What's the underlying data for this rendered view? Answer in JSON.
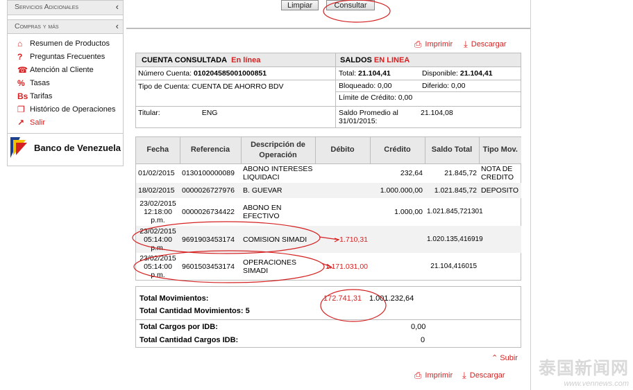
{
  "sidebar": {
    "section1": "Servicios Adicionales",
    "section2": "Compras y más",
    "items": [
      {
        "icon": "house-icon",
        "glyph": "⌂",
        "label": "Resumen de Productos"
      },
      {
        "icon": "question-icon",
        "glyph": "?",
        "label": "Preguntas Frecuentes"
      },
      {
        "icon": "phone-icon",
        "glyph": "☎",
        "label": "Atención al Cliente"
      },
      {
        "icon": "percent-icon",
        "glyph": "%",
        "label": "Tasas"
      },
      {
        "icon": "bs-icon",
        "glyph": "Bs",
        "label": "Tarifas"
      },
      {
        "icon": "history-icon",
        "glyph": "❐",
        "label": "Histórico de Operaciones"
      },
      {
        "icon": "exit-icon",
        "glyph": "↗",
        "label": "Salir"
      }
    ],
    "logo_text": "Banco de Venezuela"
  },
  "toolbar": {
    "clear_label": "Limpiar",
    "query_label": "Consultar"
  },
  "actions": {
    "print_label": "Imprimir",
    "download_label": "Descargar",
    "top_label": "Subir"
  },
  "account": {
    "title": "CUENTA CONSULTADA",
    "title_status": "En línea",
    "balances_title": "SALDOS",
    "balances_status": "EN LINEA",
    "number_label": "Número Cuenta:",
    "number_value": "010204585001000851",
    "type_label": "Tipo de Cuenta:",
    "type_value": "CUENTA DE AHORRO BDV",
    "holder_label": "Titular:",
    "holder_value": "ENG",
    "total_label": "Total:",
    "total_value": "21.104,41",
    "available_label": "Disponible:",
    "available_value": "21.104,41",
    "blocked_label": "Bloqueado: 0,00",
    "deferred_label": "Diferido: 0,00",
    "credit_limit_label": "Límite de Crédito: 0,00",
    "avg_label": "Saldo Promedio al 31/01/2015:",
    "avg_value": "21.104,08"
  },
  "movements": {
    "columns": [
      "Fecha",
      "Referencia",
      "Descripción de Operación",
      "Débito",
      "Crédito",
      "Saldo Total",
      "Tipo Mov."
    ],
    "rows": [
      {
        "fecha": "01/02/2015",
        "ref": "0130100000089",
        "desc": "ABONO INTERESES LIQUIDACI",
        "debito": "",
        "credito": "232,64",
        "saldo": "21.845,72",
        "tipo": "NOTA DE CREDITO"
      },
      {
        "fecha": "18/02/2015",
        "ref": "0000026727976",
        "desc": "B. GUEVAR",
        "debito": "",
        "credito": "1.000.000,00",
        "saldo": "1.021.845,72",
        "tipo": "DEPOSITO"
      },
      {
        "fecha": "23/02/2015 12:18:00 p.m.",
        "ref": "0000026734422",
        "desc": "ABONO EN EFECTIVO",
        "debito": "",
        "credito": "1.000,00",
        "saldo": "1.021.845,721301",
        "tipo": ""
      },
      {
        "fecha": "23/02/2015 05:14:00 p.m.",
        "ref": "9691903453174",
        "desc": "COMISION SIMADI",
        "debito": "1.710,31",
        "credito": "",
        "saldo": "1.020.135,416919",
        "tipo": ""
      },
      {
        "fecha": "23/02/2015 05:14:00 p.m.",
        "ref": "9601503453174",
        "desc": "OPERACIONES SIMADI",
        "debito": "1.171.031,00",
        "credito": "",
        "saldo": "21.104,416015",
        "tipo": ""
      }
    ]
  },
  "totals": {
    "mov_label": "Total Movimientos:",
    "mov_debit": "172.741,31",
    "mov_credit": "1.001.232,64",
    "count_label": "Total Cantidad Movimientos:",
    "count_value": "5",
    "idb_label": "Total Cargos por IDB:",
    "idb_value": "0,00",
    "idb_count_label": "Total Cantidad Cargos IDB:",
    "idb_count_value": "0"
  },
  "watermark": {
    "cn": "泰国新闻网",
    "url": "www.vennews.com"
  },
  "colors": {
    "accent_red": "#d42020",
    "header_gray": "#e9e9e9"
  }
}
